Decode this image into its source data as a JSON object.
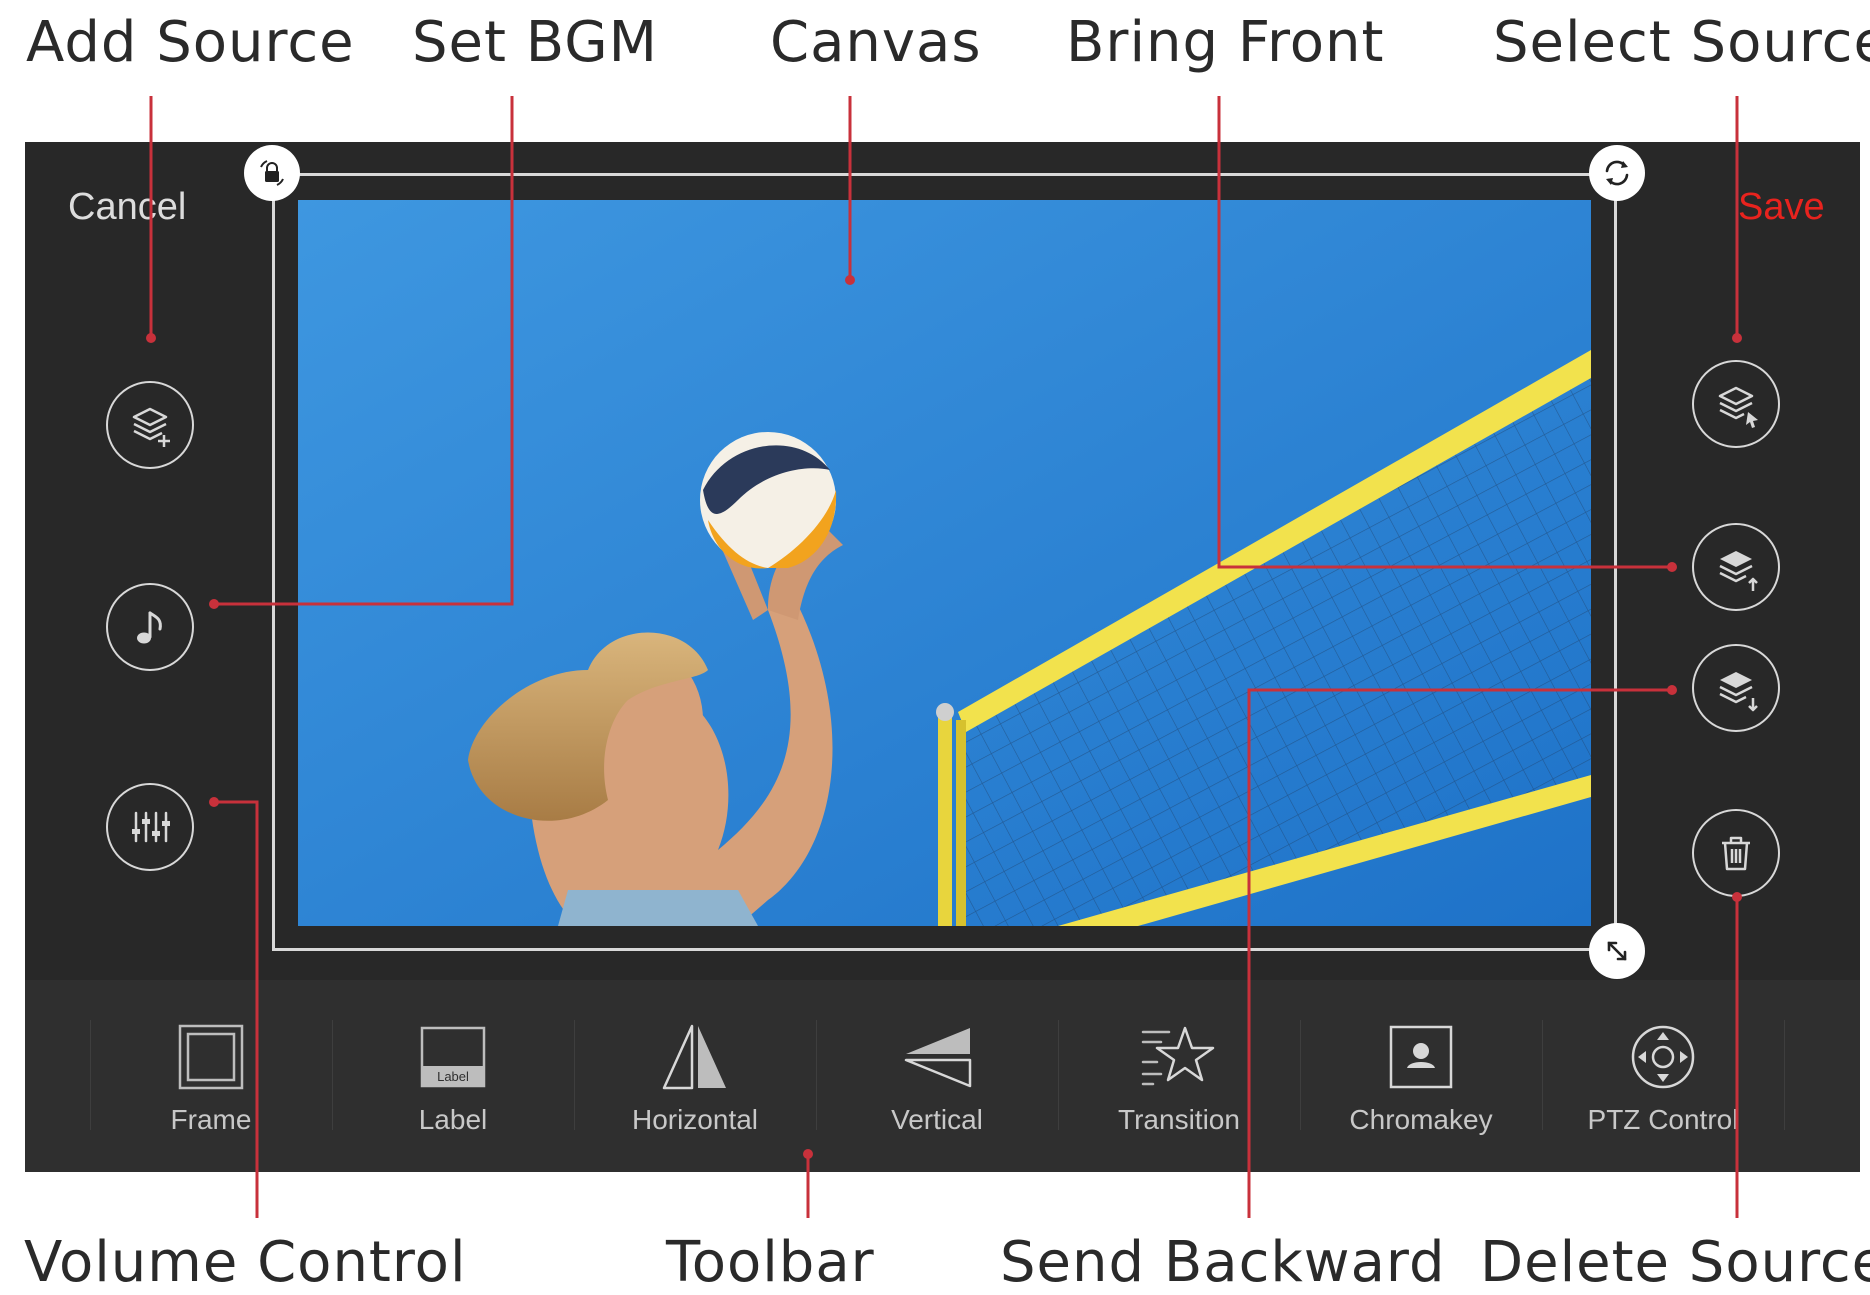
{
  "callouts": {
    "add_source": "Add Source",
    "set_bgm": "Set BGM",
    "canvas": "Canvas",
    "bring_front": "Bring Front",
    "select_source": "Select Source",
    "volume_control": "Volume Control",
    "toolbar": "Toolbar",
    "send_backward": "Send Backward",
    "delete_source": "Delete Source"
  },
  "header": {
    "cancel_label": "Cancel",
    "save_label": "Save"
  },
  "toolbar": {
    "items": [
      {
        "label": "Frame",
        "icon": "frame-icon"
      },
      {
        "label": "Label",
        "icon": "label-icon",
        "icon_text": "Label"
      },
      {
        "label": "Horizontal",
        "icon": "flip-horizontal-icon"
      },
      {
        "label": "Vertical",
        "icon": "flip-vertical-icon"
      },
      {
        "label": "Transition",
        "icon": "transition-star-icon"
      },
      {
        "label": "Chromakey",
        "icon": "chromakey-icon"
      },
      {
        "label": "PTZ Control",
        "icon": "ptz-control-icon"
      }
    ]
  },
  "left_buttons": [
    "layers-add-icon",
    "music-note-icon",
    "mixer-sliders-icon"
  ],
  "right_buttons": [
    "layers-select-icon",
    "layers-up-icon",
    "layers-down-icon",
    "trash-icon"
  ],
  "colors": {
    "device_bg": "#282828",
    "toolbar_bg": "#2f2f2f",
    "accent_red": "#e8231e",
    "callout_line": "#c8313b"
  }
}
